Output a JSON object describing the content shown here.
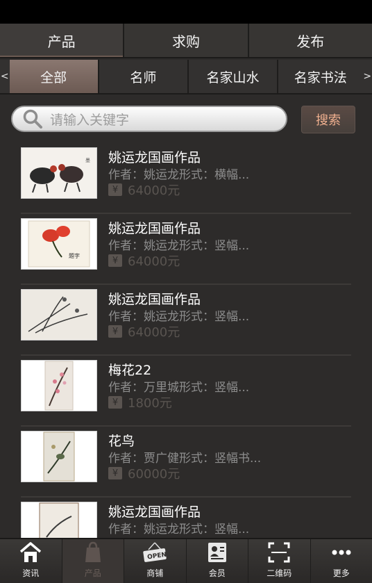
{
  "top_tabs": [
    {
      "label": "产品",
      "active": true
    },
    {
      "label": "求购",
      "active": false
    },
    {
      "label": "发布",
      "active": false
    }
  ],
  "categories": {
    "prev_arrow": "<",
    "next_arrow": ">",
    "items": [
      {
        "label": "全部",
        "active": true
      },
      {
        "label": "名师",
        "active": false
      },
      {
        "label": "名家山水",
        "active": false
      },
      {
        "label": "名家书法",
        "active": false
      }
    ]
  },
  "search": {
    "placeholder": "请输入关键字",
    "button_label": "搜索"
  },
  "products": [
    {
      "title": "姚运龙国画作品",
      "meta": "作者：姚运龙形式：横幅...",
      "price": "64000元",
      "currency_icon": "¥"
    },
    {
      "title": "姚运龙国画作品",
      "meta": "作者：姚运龙形式：竖幅...",
      "price": "64000元",
      "currency_icon": "¥"
    },
    {
      "title": "姚运龙国画作品",
      "meta": "作者：姚运龙形式：竖幅...",
      "price": "64000元",
      "currency_icon": "¥"
    },
    {
      "title": "梅花22",
      "meta": "作者：万里城形式：竖幅...",
      "price": "1800元",
      "currency_icon": "¥"
    },
    {
      "title": "花鸟",
      "meta": "作者：贾广健形式：竖幅书...",
      "price": "60000元",
      "currency_icon": "¥"
    },
    {
      "title": "姚运龙国画作品",
      "meta": "作者：姚运龙形式：竖幅...",
      "price": "",
      "currency_icon": "¥"
    }
  ],
  "bottom_nav": [
    {
      "label": "资讯",
      "icon": "home-icon",
      "active": false
    },
    {
      "label": "产品",
      "icon": "bag-icon",
      "active": true
    },
    {
      "label": "商铺",
      "icon": "open-sign-icon",
      "active": false
    },
    {
      "label": "会员",
      "icon": "member-card-icon",
      "active": false
    },
    {
      "label": "二维码",
      "icon": "qr-scan-icon",
      "active": false
    },
    {
      "label": "更多",
      "icon": "more-dots-icon",
      "active": false
    }
  ],
  "colors": {
    "background": "#2d2b2a",
    "accent": "#7a6760",
    "search_button_text": "#f0b08f"
  }
}
